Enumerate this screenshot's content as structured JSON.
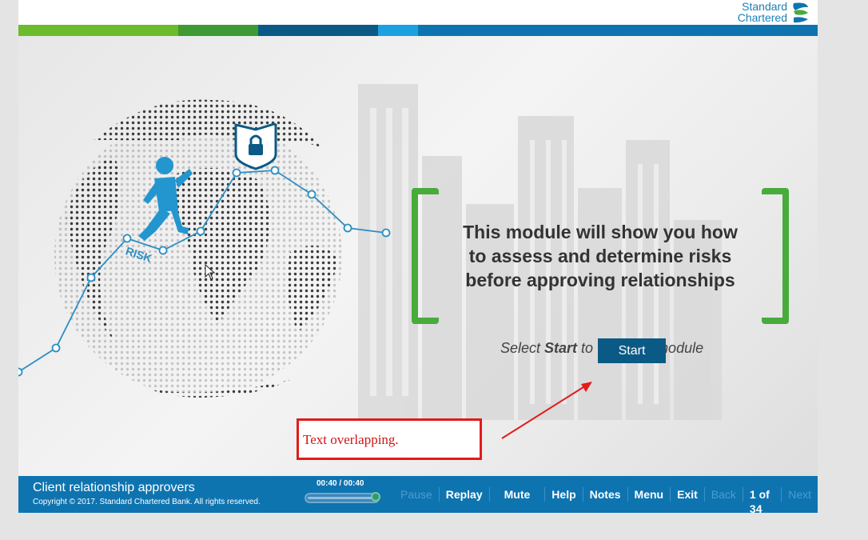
{
  "brand": {
    "line1": "Standard",
    "line2": "Chartered",
    "colors": {
      "green": "#48ab3c",
      "blue": "#0e74b0",
      "dark_blue": "#0b5a85"
    }
  },
  "stage": {
    "message": [
      "This module will show you how",
      "to assess and determine risks",
      "before approving relationships"
    ],
    "risk_label": "RISK",
    "start_prefix": "Select ",
    "start_word": "Start",
    "start_middle": " to ",
    "start_suffix": "module",
    "start_button": "Start"
  },
  "annotation": {
    "text": "Text overlapping."
  },
  "footer": {
    "course_title": "Client relationship approvers",
    "copyright": "Copyright © 2017. Standard Chartered Bank. All rights reserved.",
    "timer": "00:40 / 00:40",
    "progress": 1.0,
    "nav": {
      "pause": "Pause",
      "replay": "Replay",
      "mute": "Mute",
      "help": "Help",
      "notes": "Notes",
      "menu": "Menu",
      "exit": "Exit",
      "back": "Back",
      "page": "1 of 34",
      "next": "Next"
    }
  }
}
